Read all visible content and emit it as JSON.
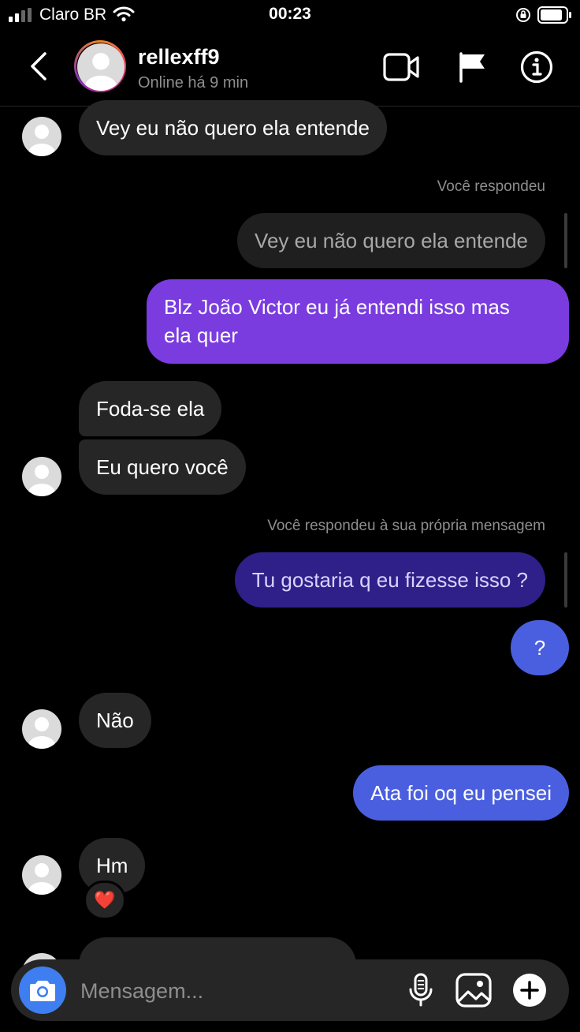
{
  "status_bar": {
    "carrier": "Claro BR",
    "time": "00:23"
  },
  "header": {
    "username": "rellexff9",
    "status": "Online há 9 min"
  },
  "messages": {
    "m1": "Vey eu não quero ela entende",
    "reply_label_1": "Você respondeu",
    "m2_quoted": "Vey eu não quero ela entende",
    "m2_line1": "Blz João Victor eu já entendi isso mas",
    "m2_line2": "ela quer",
    "m3": "Foda-se ela",
    "m4": "Eu quero você",
    "reply_label_2": "Você respondeu à sua própria mensagem",
    "m5_quoted": "Tu gostaria q eu fizesse isso ?",
    "m6": "?",
    "m7": "Não",
    "m8": "Ata foi oq eu pensei",
    "m9": "Hm",
    "m9_reaction": "❤️"
  },
  "composer": {
    "placeholder": "Mensagem..."
  },
  "colors": {
    "accent_purple": "#7a3cdf",
    "accent_blue": "#4a5fdf",
    "camera": "#3e7ef0"
  }
}
